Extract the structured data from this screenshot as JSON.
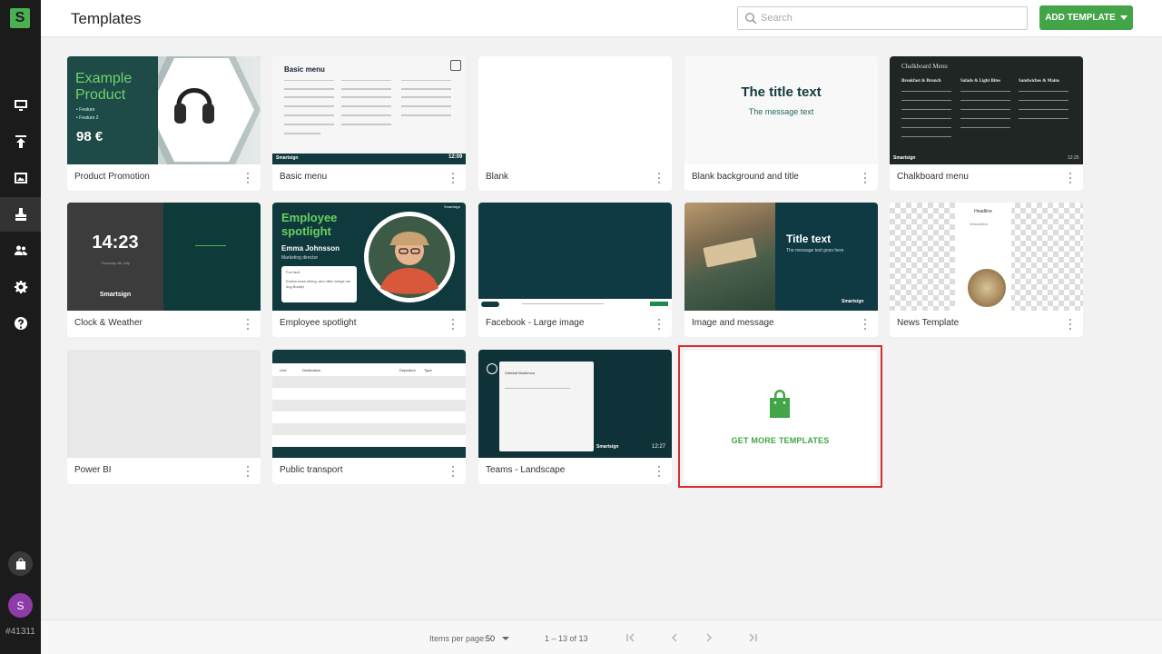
{
  "app": {
    "logo_letter": "S",
    "account_id": "#41311",
    "avatar_letter": "S"
  },
  "header": {
    "title": "Templates",
    "search_placeholder": "Search",
    "add_button": "ADD TEMPLATE"
  },
  "sidebar": {
    "items": [
      {
        "icon": "monitor-icon",
        "name": "screens"
      },
      {
        "icon": "upload-icon",
        "name": "publish"
      },
      {
        "icon": "image-icon",
        "name": "media"
      },
      {
        "icon": "stamp-icon",
        "name": "templates",
        "active": true
      },
      {
        "icon": "users-icon",
        "name": "users"
      },
      {
        "icon": "gear-icon",
        "name": "settings"
      },
      {
        "icon": "help-icon",
        "name": "help"
      }
    ]
  },
  "templates": [
    {
      "label": "Product Promotion"
    },
    {
      "label": "Basic menu"
    },
    {
      "label": "Blank"
    },
    {
      "label": "Blank background and title"
    },
    {
      "label": "Chalkboard menu"
    },
    {
      "label": "Clock & Weather"
    },
    {
      "label": "Employee spotlight"
    },
    {
      "label": "Facebook - Large image"
    },
    {
      "label": "Image and message"
    },
    {
      "label": "News Template"
    },
    {
      "label": "Power BI"
    },
    {
      "label": "Public transport"
    },
    {
      "label": "Teams - Landscape"
    }
  ],
  "thumbs": {
    "product": {
      "title_line1": "Example",
      "title_line2": "Product",
      "feature1": "• Feature",
      "feature2": "• Feature 2",
      "price": "98 €"
    },
    "basic_menu": {
      "title": "Basic menu",
      "brand": "Smartsign",
      "time": "12:09"
    },
    "blank_title": {
      "title": "The title text",
      "message": "The message text"
    },
    "chalkboard": {
      "title": "Chalkboard Menu",
      "col1": "Breakfast & Brunch",
      "col2": "Salads & Light Bites",
      "col3": "Sandwiches & Mains",
      "brand": "Smartsign",
      "time": "12:25"
    },
    "clock": {
      "time": "14:23",
      "date": "Thursday 4th July",
      "brand": "Smartsign"
    },
    "employee": {
      "title_line1": "Employee",
      "title_line2": "spotlight",
      "name": "Emma Johnsson",
      "role": "Marketing director",
      "fun_fact": "Fun fact!",
      "fact_text": "Emma loves hiking, and often brings her dog Buddy!",
      "brand": "Smartsign"
    },
    "image_message": {
      "title": "Title text",
      "message": "The message text goes here",
      "brand": "Smartsign"
    },
    "news": {
      "headline": "Headline",
      "description": "Description"
    },
    "transport": {
      "col_line": "Line",
      "col_destination": "Destination",
      "col_departure": "Departure",
      "col_type": "Type"
    },
    "teams": {
      "brand": "Smartsign",
      "time": "12:27",
      "card_title": "Gatekat Madrenca"
    }
  },
  "get_more": {
    "label": "GET MORE TEMPLATES"
  },
  "footer": {
    "items_per_page_label": "Items per page:",
    "items_per_page_value": "50",
    "range": "1 – 13 of 13"
  },
  "colors": {
    "accent": "#43a547",
    "sidebar": "#1b1b1b",
    "highlight_border": "#d32f2f"
  }
}
